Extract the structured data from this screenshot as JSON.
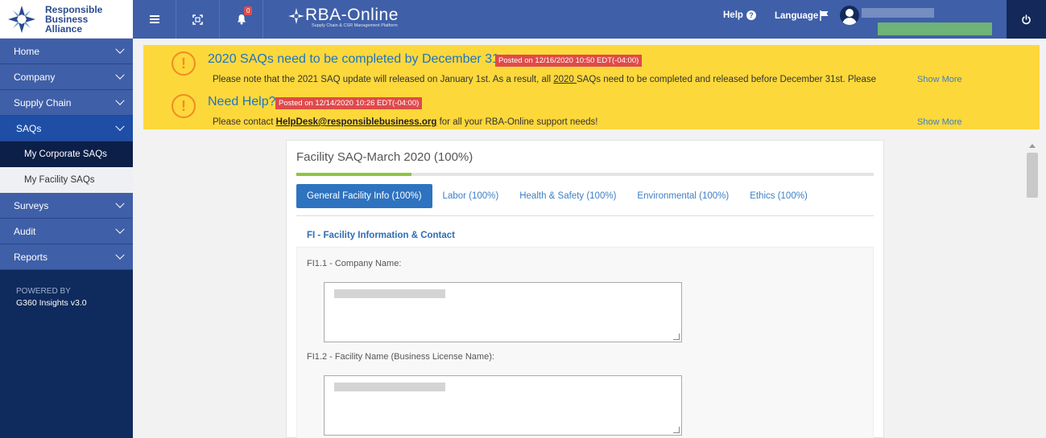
{
  "brand": {
    "logo_line1": "Responsible",
    "logo_line2": "Business",
    "logo_line3": "Alliance",
    "app_name": "RBA-Online",
    "app_tagline": "Supply Chain & CSR Management Platform"
  },
  "topbar": {
    "notification_count": "0",
    "help_label": "Help",
    "language_label": "Language"
  },
  "sidebar": {
    "items": [
      {
        "label": "Home"
      },
      {
        "label": "Company"
      },
      {
        "label": "Supply Chain"
      },
      {
        "label": "SAQs"
      },
      {
        "label": "Surveys"
      },
      {
        "label": "Audit"
      },
      {
        "label": "Reports"
      }
    ],
    "saq_subitems": [
      {
        "label": "My Corporate SAQs"
      },
      {
        "label": "My Facility SAQs"
      }
    ],
    "powered_by": "POWERED BY",
    "version": "G360 Insights v3.0"
  },
  "notices": [
    {
      "title": "2020 SAQs need to be completed by December 31st.",
      "posted": "Posted on 12/16/2020 10:50 EDT(-04:00)",
      "body_prefix": "Please note that the 2021 SAQ update will released on January 1st. As a result, all ",
      "body_underlined": "2020 ",
      "body_suffix": "SAQs need to be completed and released before December 31st. Please",
      "more": "Show More"
    },
    {
      "title": "Need Help?",
      "posted": "Posted on 12/14/2020 10:26 EDT(-04:00)",
      "body_prefix": "Please contact ",
      "body_link": "HelpDesk@responsiblebusiness.org",
      "body_suffix": " for all your RBA-Online support needs!",
      "more": "Show More"
    }
  ],
  "saq": {
    "title": "Facility SAQ-March 2020 (100%)",
    "progress_fraction": 0.2,
    "tabs": [
      {
        "label": "General Facility Info (100%)"
      },
      {
        "label": "Labor (100%)"
      },
      {
        "label": "Health & Safety (100%)"
      },
      {
        "label": "Environmental (100%)"
      },
      {
        "label": "Ethics (100%)"
      }
    ],
    "section_title": "FI - Facility Information & Contact",
    "fields": [
      {
        "label": "FI1.1 - Company Name:"
      },
      {
        "label": "FI1.2 - Facility Name (Business License Name):"
      }
    ]
  },
  "colors": {
    "sidebar_bg": "#0f2a5c",
    "topbar_bg": "#3f5fa8",
    "banner_bg": "#fdd83b",
    "accent_blue": "#2e73c0",
    "progress_green": "#8cc63f",
    "alert_orange": "#f08c23",
    "date_red": "#e04a4a"
  },
  "icons": {
    "menu": "hamburger-icon",
    "fullscreen": "expand-icon",
    "notifications": "bell-icon",
    "help": "question-circle-icon",
    "language": "flag-icon",
    "user": "user-avatar-icon",
    "logout": "power-icon",
    "alert": "exclamation-circle-icon"
  }
}
